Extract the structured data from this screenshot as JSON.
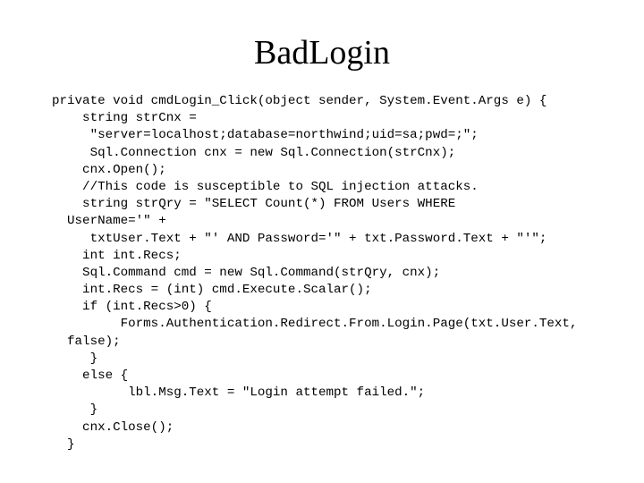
{
  "slide": {
    "title": "BadLogin",
    "background_color": "#ffffff",
    "text_color": "#000000",
    "code_lines": [
      "private void cmdLogin_Click(object sender, System.Event.Args e) {",
      "    string strCnx =",
      "     \"server=localhost;database=northwind;uid=sa;pwd=;\";",
      "     Sql.Connection cnx = new Sql.Connection(strCnx);",
      "    cnx.Open();",
      "    //This code is susceptible to SQL injection attacks.",
      "    string strQry = \"SELECT Count(*) FROM Users WHERE",
      "  UserName='\" +",
      "     txtUser.Text + \"' AND Password='\" + txt.Password.Text + \"'\";",
      "    int int.Recs;",
      "    Sql.Command cmd = new Sql.Command(strQry, cnx);",
      "    int.Recs = (int) cmd.Execute.Scalar();",
      "    if (int.Recs>0) {",
      "         Forms.Authentication.Redirect.From.Login.Page(txt.User.Text,",
      "  false);",
      "     }",
      "    else {",
      "          lbl.Msg.Text = \"Login attempt failed.\";",
      "     }",
      "    cnx.Close();",
      "  }"
    ]
  }
}
